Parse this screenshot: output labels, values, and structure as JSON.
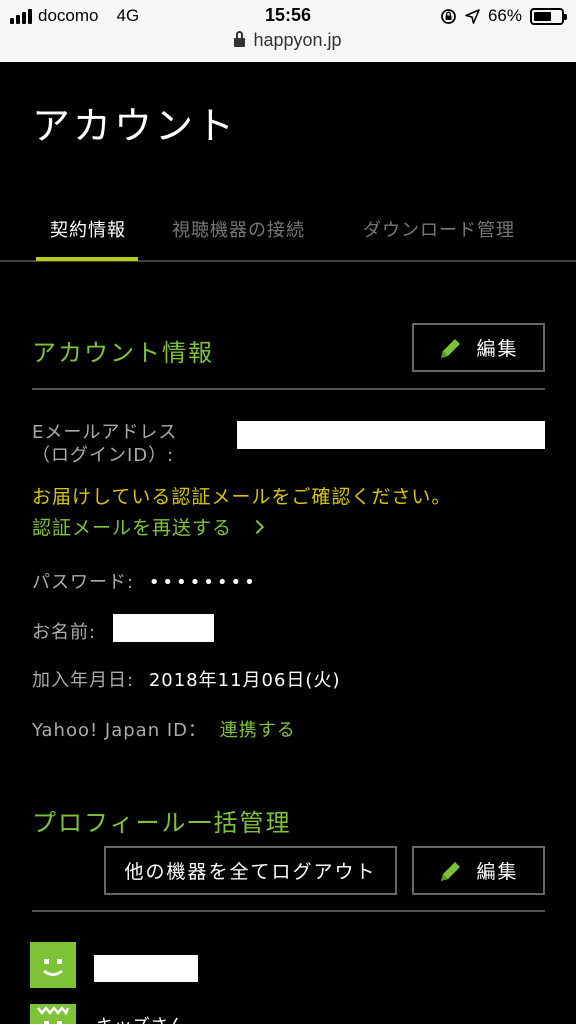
{
  "status_bar": {
    "carrier": "docomo",
    "network": "4G",
    "time": "15:56",
    "battery": "66%",
    "battery_level": 0.66
  },
  "browser": {
    "url": "happyon.jp"
  },
  "page": {
    "title": "アカウント"
  },
  "tabs": [
    {
      "label": "契約情報",
      "active": true
    },
    {
      "label": "視聴機器の接続",
      "active": false
    },
    {
      "label": "ダウンロード管理",
      "active": false
    }
  ],
  "account_section": {
    "title": "アカウント情報",
    "edit_label": "編集",
    "email_label_line1": "Eメールアドレス",
    "email_label_line2": "（ログインID）:",
    "notice": "お届けしている認証メールをご確認ください。",
    "resend_link": "認証メールを再送する",
    "password_label": "パスワード:",
    "password_value": "••••••••",
    "name_label": "お名前:",
    "joined_label": "加入年月日:",
    "joined_value": "2018年11月06日(火)",
    "yahoo_label": "Yahoo! Japan ID：",
    "yahoo_link": "連携する"
  },
  "profile_section": {
    "title": "プロフィール一括管理",
    "logout_all_label": "他の機器を全てログアウト",
    "edit_label": "編集",
    "profiles": [
      {
        "name": ""
      },
      {
        "name": "キッズさん"
      }
    ]
  },
  "colors": {
    "accent_green": "#7ec337",
    "tab_underline": "#b5cc18",
    "notice_yellow": "#d8c400"
  }
}
